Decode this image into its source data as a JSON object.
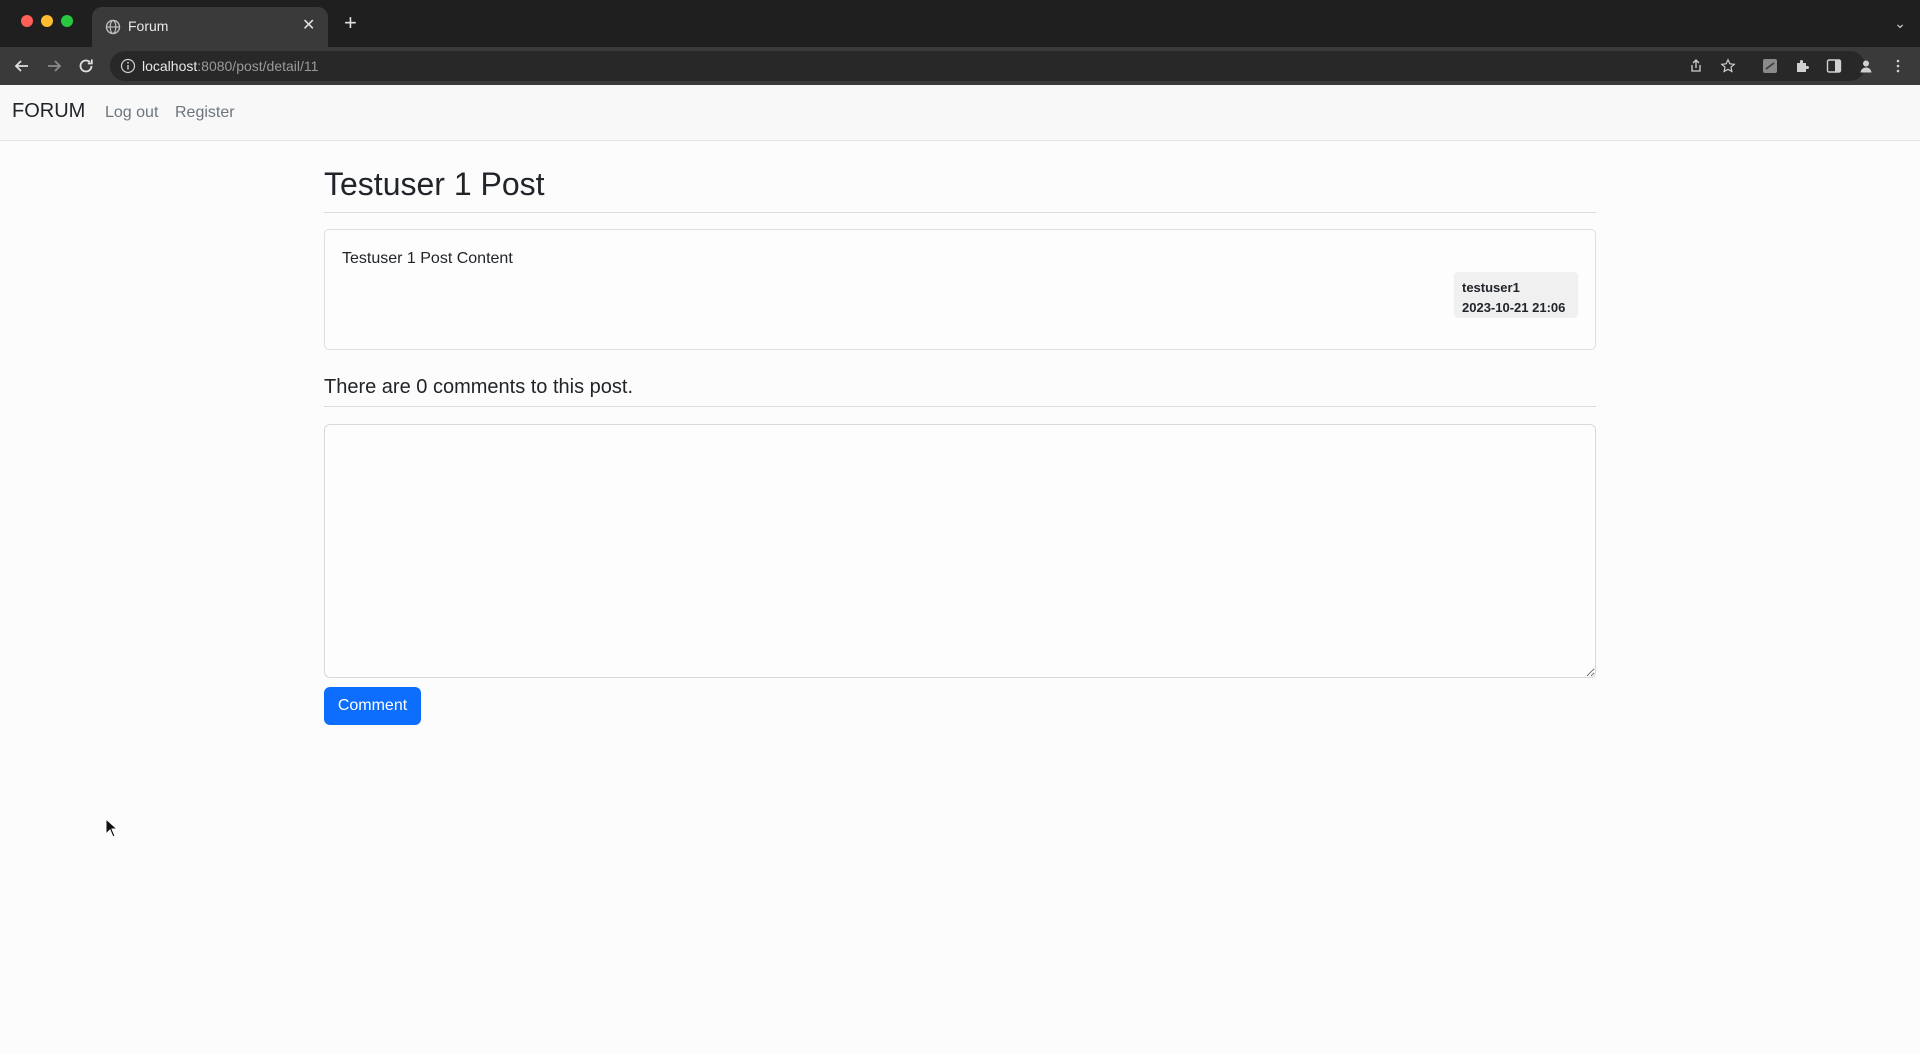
{
  "browser": {
    "tab_title": "Forum",
    "tab_close": "✕",
    "new_tab": "+",
    "tab_menu": "⌄",
    "url_host": "localhost",
    "url_rest": ":8080/post/detail/11"
  },
  "navbar": {
    "brand": "FORUM",
    "links": [
      "Log out",
      "Register"
    ]
  },
  "post": {
    "title": "Testuser 1 Post",
    "content": "Testuser 1 Post Content",
    "author": "testuser1",
    "date": "2023-10-21 21:06"
  },
  "comments": {
    "heading": "There are 0 comments to this post.",
    "textarea_value": "",
    "button_label": "Comment"
  },
  "colors": {
    "primary": "#0d6efd",
    "chrome_dark": "#1f1f1f",
    "chrome_toolbar": "#3a3a3a"
  }
}
